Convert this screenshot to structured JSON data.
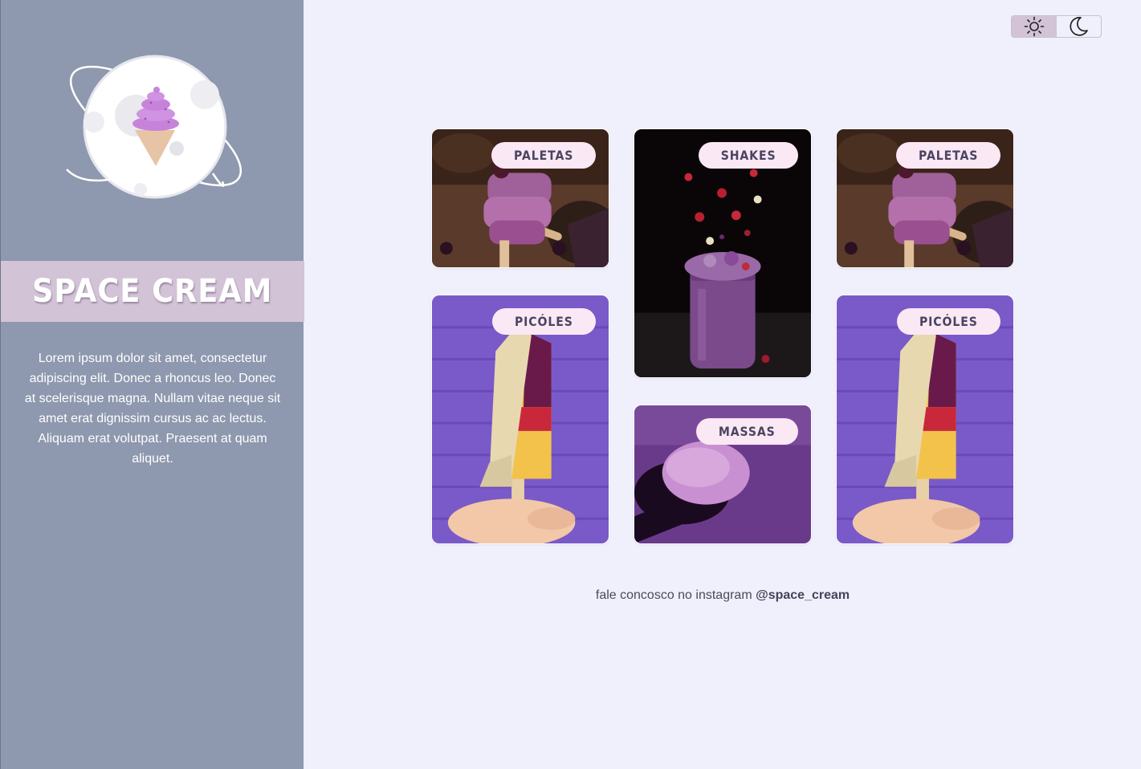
{
  "sidebar": {
    "brand_title": "SPACE CREAM",
    "logo_icon": "ice-cream-planet-icon",
    "description": "Lorem ipsum dolor sit amet, consectetur adipiscing elit. Donec a rhoncus leo. Donec at scelerisque magna. Nullam vitae neque sit amet erat dignissim cursus ac ac lectus. Aliquam erat volutpat. Praesent at quam aliquet."
  },
  "theme_toggle": {
    "options": [
      {
        "icon": "sun-icon",
        "active": true
      },
      {
        "icon": "moon-icon",
        "active": false
      }
    ]
  },
  "gallery": {
    "cards": [
      {
        "label": "PALETAS",
        "image": "purple-popsicles-photo"
      },
      {
        "label": "SHAKES",
        "image": "berry-shake-jar-photo"
      },
      {
        "label": "PALETAS",
        "image": "purple-popsicles-photo"
      },
      {
        "label": "PICÓLES",
        "image": "layered-popsicle-photo"
      },
      {
        "label": "MASSAS",
        "image": "ice-cream-scoop-photo"
      },
      {
        "label": "PICÓLES",
        "image": "layered-popsicle-photo"
      }
    ]
  },
  "footer": {
    "text": "fale concosco no instagram ",
    "handle": "@space_cream"
  },
  "colors": {
    "sidebar_bg": "#8e98ae",
    "brand_band": "#d3c3d7",
    "page_bg": "#f0f0fc",
    "badge_bg": "#fbe8f5",
    "badge_text": "#4a4560"
  }
}
